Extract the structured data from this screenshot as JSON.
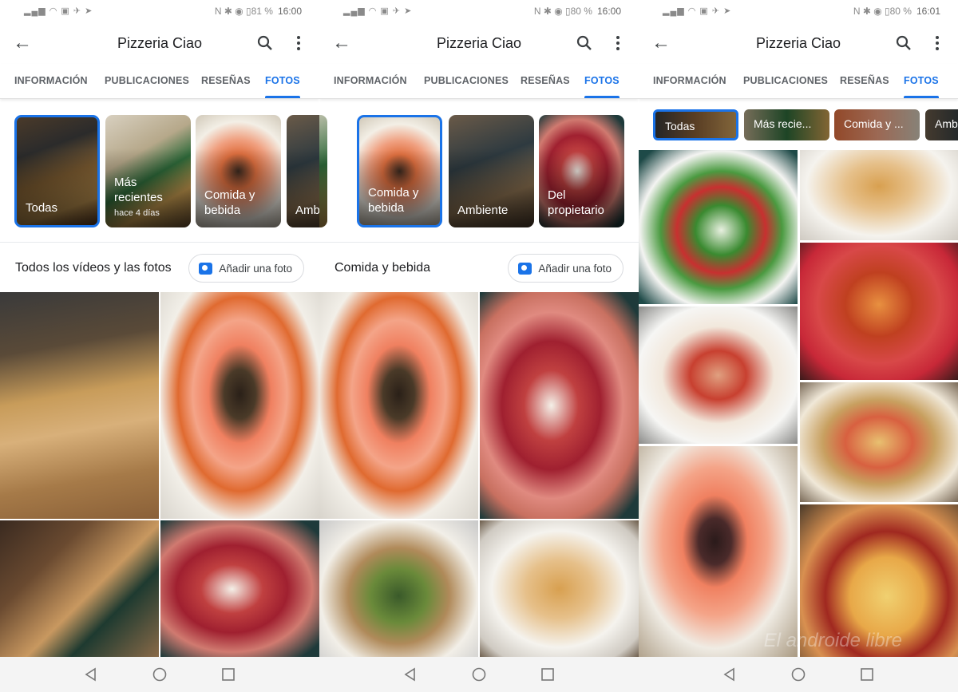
{
  "status": {
    "p1": {
      "battery": "81 %",
      "time": "16:00"
    },
    "p2": {
      "battery": "80 %",
      "time": "16:00"
    },
    "p3": {
      "battery": "80 %",
      "time": "16:01"
    }
  },
  "appbar": {
    "title": "Pizzeria Ciao"
  },
  "tabs": [
    "INFORMACIÓN",
    "PUBLICACIONES",
    "RESEÑAS",
    "FOTOS"
  ],
  "p1": {
    "categories": [
      {
        "label": "Todas",
        "sub": ""
      },
      {
        "label": "Más recientes",
        "sub": "hace 4 días"
      },
      {
        "label": "Comida y bebida",
        "sub": ""
      },
      {
        "label": "Amb",
        "sub": ""
      }
    ],
    "section_title": "Todos los vídeos y las fotos",
    "add_photo": "Añadir una foto"
  },
  "p2": {
    "categories": [
      {
        "label": "Comida y bebida"
      },
      {
        "label": "Ambiente"
      },
      {
        "label": "Del propietario"
      }
    ],
    "section_title": "Comida y bebida",
    "add_photo": "Añadir una foto"
  },
  "p3": {
    "chips": [
      "Todas",
      "Más recie...",
      "Comida y ...",
      "Amb"
    ]
  },
  "watermark": "El androide libre",
  "colors": {
    "accent": "#1a73e8"
  }
}
